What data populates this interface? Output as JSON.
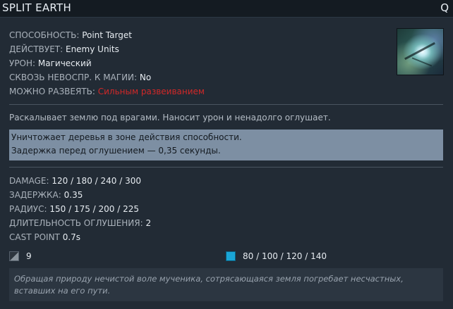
{
  "header": {
    "title": "SPLIT EARTH",
    "hotkey": "Q"
  },
  "icon": {
    "name": "split-earth-ability-icon"
  },
  "stats": [
    {
      "label": "СПОСОБНОСТЬ:",
      "value": "Point Target"
    },
    {
      "label": "ДЕЙСТВУЕТ:",
      "value": "Enemy Units"
    },
    {
      "label": "УРОН:",
      "value": "Магический"
    },
    {
      "label": "СКВОЗЬ НЕВОСПР. К МАГИИ:",
      "value": "No"
    },
    {
      "label": "МОЖНО РАЗВЕЯТЬ:",
      "value": "Сильным развеиванием",
      "value_color": "#d12828"
    }
  ],
  "description": "Раскалывает землю под врагами. Наносит урон и ненадолго оглушает.",
  "notes": [
    "Уничтожает деревья в зоне действия способности.",
    "Задержка перед оглушением — 0,35 секунды."
  ],
  "attributes": [
    {
      "label": "DAMAGE:",
      "value": "120 / 180 / 240 / 300"
    },
    {
      "label": "ЗАДЕРЖКА:",
      "value": "0.35"
    },
    {
      "label": "РАДИУС:",
      "value": "150 / 175 / 200 / 225"
    },
    {
      "label": "ДЛИТЕЛЬНОСТЬ ОГЛУШЕНИЯ:",
      "value": "2"
    },
    {
      "label": "CAST POINT",
      "value": "0.7s"
    }
  ],
  "costs": {
    "cooldown": {
      "icon": "cooldown-icon",
      "value": "9"
    },
    "mana": {
      "icon": "mana-icon",
      "value": "80 / 100 / 120 / 140",
      "color": "#1aa5d6"
    }
  },
  "lore": "Обращая природу нечистой воле мученика, сотрясающаяся земля погребает несчастных, вставших на его пути."
}
